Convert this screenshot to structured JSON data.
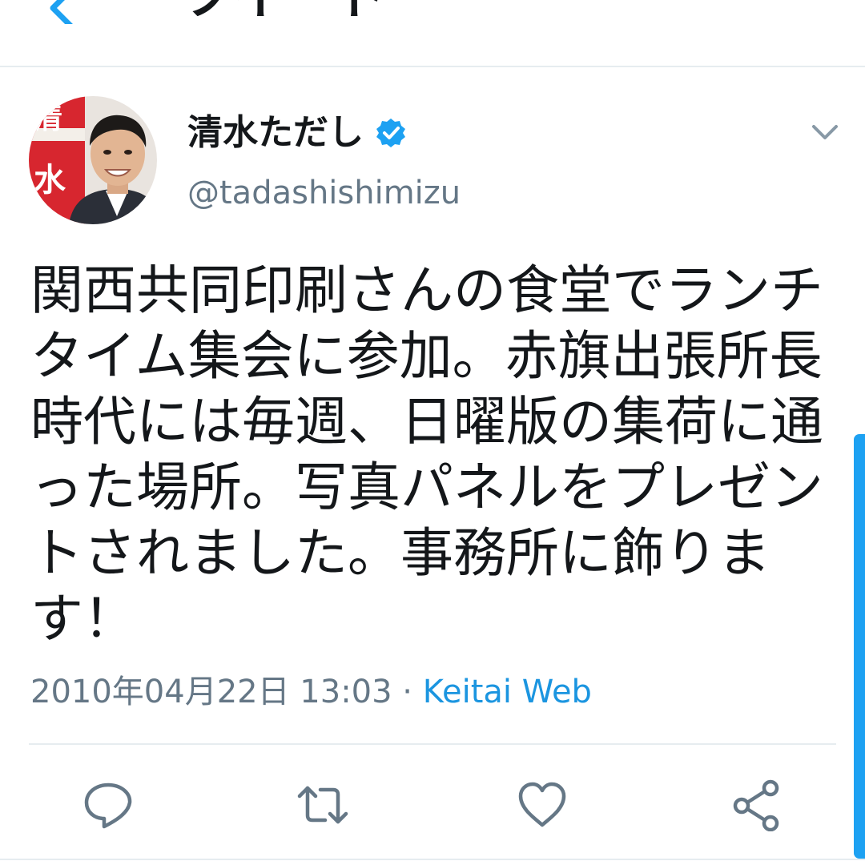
{
  "header": {
    "title": "ツイート"
  },
  "author": {
    "display_name": "清水ただし",
    "handle": "@tadashishimizu",
    "verified": true,
    "avatar_poster_text": "清水"
  },
  "tweet": {
    "text": "関西共同印刷さんの食堂でランチタイム集会に参加。赤旗出張所長時代には毎週、日曜版の集荷に通った場所。写真パネルをプレゼントされました。事務所に飾ります！",
    "date": "2010年04月22日 13:03",
    "separator": " · ",
    "source": "Keitai Web"
  },
  "actions": [
    {
      "name": "reply",
      "icon": "reply-icon"
    },
    {
      "name": "retweet",
      "icon": "retweet-icon"
    },
    {
      "name": "like",
      "icon": "heart-icon"
    },
    {
      "name": "share",
      "icon": "share-icon"
    }
  ],
  "colors": {
    "accent": "#1da1f2",
    "link": "#1b95e0",
    "secondary_text": "#657786",
    "divider": "#e6ecf0",
    "icon": "#657786"
  }
}
